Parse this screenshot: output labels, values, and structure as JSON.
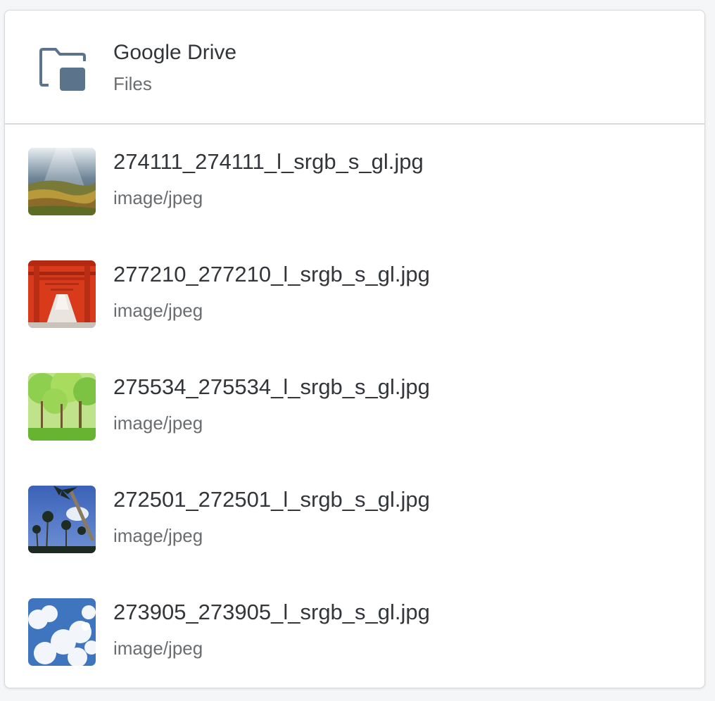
{
  "header": {
    "title": "Google Drive",
    "subtitle": "Files",
    "icon": "folder-icon",
    "icon_color": "#5b738b"
  },
  "files": [
    {
      "name": "274111_274111_l_srgb_s_gl.jpg",
      "type": "image/jpeg",
      "thumbnail": "landscape-sun-rays-thumbnail"
    },
    {
      "name": "277210_277210_l_srgb_s_gl.jpg",
      "type": "image/jpeg",
      "thumbnail": "red-torii-gates-thumbnail"
    },
    {
      "name": "275534_275534_l_srgb_s_gl.jpg",
      "type": "image/jpeg",
      "thumbnail": "green-forest-thumbnail"
    },
    {
      "name": "272501_272501_l_srgb_s_gl.jpg",
      "type": "image/jpeg",
      "thumbnail": "palm-trees-sky-thumbnail"
    },
    {
      "name": "273905_273905_l_srgb_s_gl.jpg",
      "type": "image/jpeg",
      "thumbnail": "cloudy-sky-thumbnail"
    }
  ],
  "colors": {
    "text_primary": "#32363a",
    "text_secondary": "#6a6d70",
    "divider": "#d9d9d9"
  }
}
